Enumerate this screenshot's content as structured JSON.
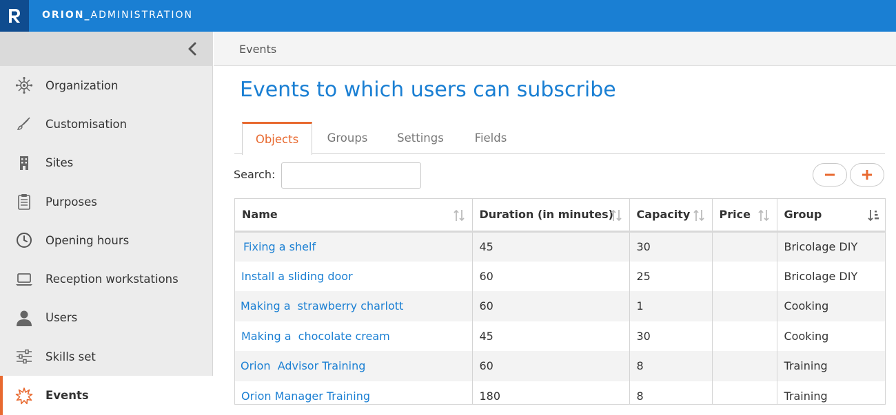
{
  "app": {
    "title_strong": "ORION_",
    "title_light": "ADMINISTRATION",
    "logo_letter": "R"
  },
  "colors": {
    "topbar": "#1a7fd3",
    "logo_bg": "#0f4c8f",
    "accent": "#e8692f",
    "link": "#1a7fd3"
  },
  "sidebar": {
    "collapse_icon": "chevron-left-icon",
    "items": [
      {
        "label": "Organization",
        "icon": "network-icon"
      },
      {
        "label": "Customisation",
        "icon": "brush-icon"
      },
      {
        "label": "Sites",
        "icon": "building-icon"
      },
      {
        "label": "Purposes",
        "icon": "clipboard-icon"
      },
      {
        "label": "Opening hours",
        "icon": "clock-icon"
      },
      {
        "label": "Reception workstations",
        "icon": "laptop-icon"
      },
      {
        "label": "Users",
        "icon": "user-icon"
      },
      {
        "label": "Skills set",
        "icon": "sliders-icon"
      },
      {
        "label": "Events",
        "icon": "starburst-icon",
        "active": true
      }
    ]
  },
  "breadcrumb": "Events",
  "page_title": "Events to which users can subscribe",
  "tabs": [
    {
      "label": "Objects",
      "active": true
    },
    {
      "label": "Groups"
    },
    {
      "label": "Settings"
    },
    {
      "label": "Fields"
    }
  ],
  "search": {
    "label": "Search:",
    "value": ""
  },
  "buttons": {
    "remove_icon": "minus-icon",
    "add_icon": "plus-icon"
  },
  "table": {
    "columns": [
      "Name",
      "Duration (in minutes)",
      "Capacity",
      "Price",
      "Group"
    ],
    "rows": [
      [
        "Fixing a shelf",
        "45",
        "30",
        "",
        "Bricolage DIY"
      ],
      [
        "Install a sliding door",
        "60",
        "25",
        "",
        "Bricolage DIY"
      ],
      [
        "Making a  strawberry charlott",
        "60",
        "1",
        "",
        "Cooking"
      ],
      [
        "Making a  chocolate cream",
        "45",
        "30",
        "",
        "Cooking"
      ],
      [
        "Orion  Advisor Training",
        "60",
        "8",
        "",
        "Training"
      ],
      [
        "Orion Manager Training",
        "180",
        "8",
        "",
        "Training"
      ]
    ]
  }
}
